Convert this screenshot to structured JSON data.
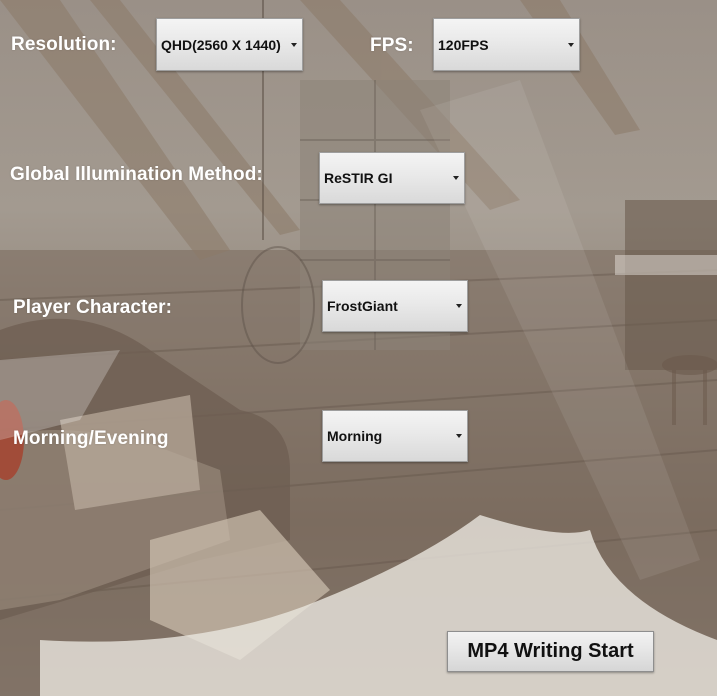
{
  "settings": {
    "resolution": {
      "label": "Resolution:",
      "value": "QHD(2560 X 1440)"
    },
    "fps": {
      "label": "FPS:",
      "value": "120FPS"
    },
    "gi_method": {
      "label": "Global Illumination Method:",
      "value": "ReSTIR GI"
    },
    "player_character": {
      "label": "Player Character:",
      "value": "FrostGiant"
    },
    "time_of_day": {
      "label": "Morning/Evening",
      "value": "Morning"
    }
  },
  "actions": {
    "start_label": "MP4 Writing Start"
  },
  "background": {
    "description_icon": "attic-scene-background"
  },
  "colors": {
    "label_text": "#ffffff",
    "control_face": "#e6e6e6",
    "control_text": "#111111"
  }
}
